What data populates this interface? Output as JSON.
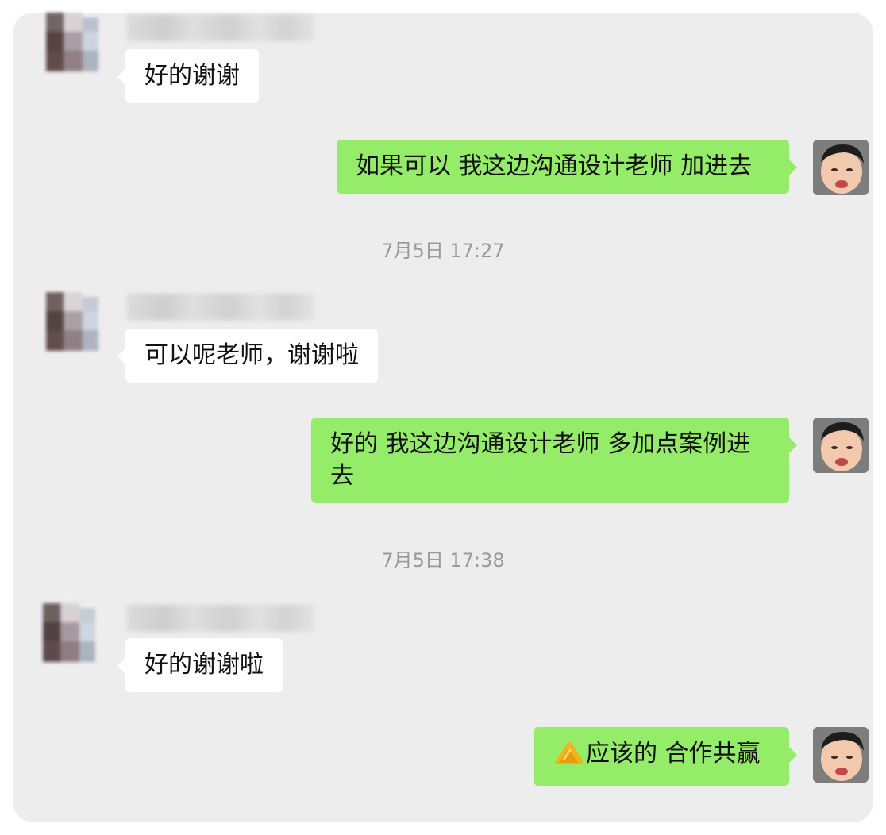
{
  "messages": {
    "m1": {
      "text": "好的谢谢"
    },
    "m2": {
      "text": "如果可以  我这边沟通设计老师 加进去"
    },
    "m3": {
      "text": "可以呢老师，谢谢啦"
    },
    "m4": {
      "text": "好的 我这边沟通设计老师  多加点案例进去"
    },
    "m5": {
      "text": "好的谢谢啦"
    },
    "m6": {
      "text": "应该的 合作共赢",
      "emoji": "handshake-icon"
    }
  },
  "timestamps": {
    "t1": "7月5日 17:27",
    "t2": "7月5日 17:38"
  },
  "colors": {
    "chat_bg": "#ededed",
    "self_bubble": "#95ec69",
    "other_bubble": "#ffffff",
    "timestamp_text": "#9a9a9a"
  }
}
